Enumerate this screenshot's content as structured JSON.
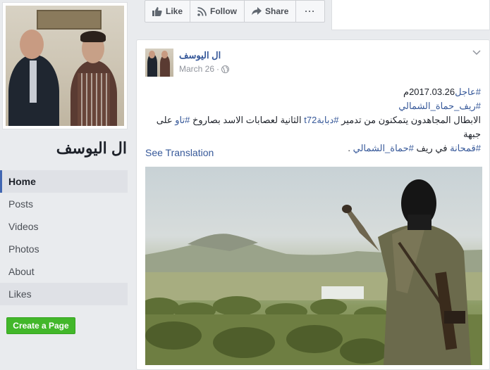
{
  "sidebar": {
    "page_name": "ال اليوسف",
    "nav": [
      {
        "label": "Home"
      },
      {
        "label": "Posts"
      },
      {
        "label": "Videos"
      },
      {
        "label": "Photos"
      },
      {
        "label": "About"
      },
      {
        "label": "Likes"
      }
    ],
    "create_page_label": "Create a Page"
  },
  "actions": {
    "like_label": "Like",
    "follow_label": "Follow",
    "share_label": "Share",
    "more_label": "···"
  },
  "post": {
    "author": "ال اليوسف",
    "date": "March 26",
    "dot": "·",
    "line1_tag": "#عاجل",
    "line1_text": "2017.03.26م",
    "line2_tag": "#ريف_حماة_الشمالي",
    "line3_part1": "الابطال المجاهدون يتمكنون من تدمير ",
    "line3_tag1": "#دبابة",
    "line3_tag1b": "t72",
    "line3_part2": " الثانية لعصابات الاسد بصاروخ ",
    "line3_tag2": "#تاو",
    "line3_part3": " على جبهة",
    "line4_tag1": "#قمحانة",
    "line4_part1": " في ريف ",
    "line4_tag2": "#حماة_الشمالي",
    "line4_part2": " .",
    "see_translation": "See Translation"
  },
  "colors": {
    "brand_blue": "#4267b2",
    "link_blue": "#365899",
    "create_green": "#42b72a",
    "background": "#e9ebee"
  },
  "icons": [
    "like-icon",
    "rss-icon",
    "share-icon",
    "globe-icon",
    "chevron-down-icon"
  ]
}
